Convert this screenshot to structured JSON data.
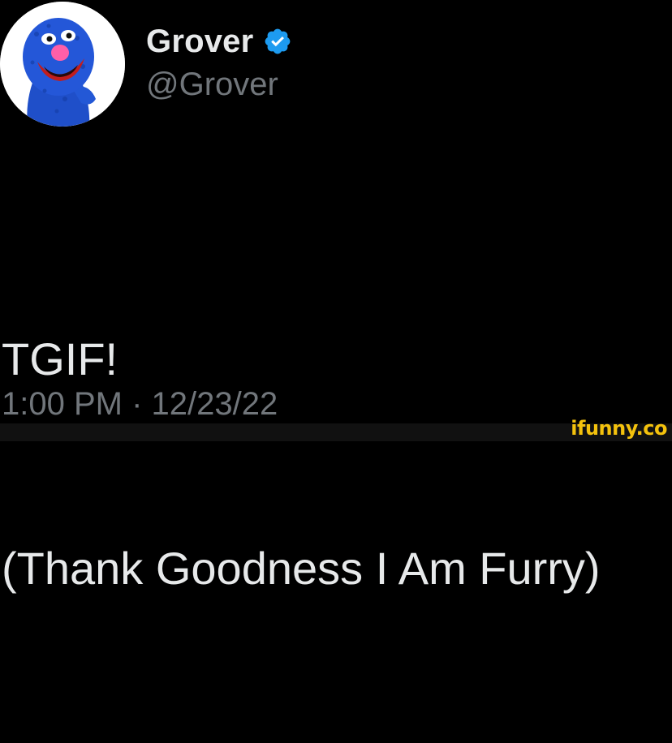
{
  "profile": {
    "display_name": "Grover",
    "handle": "@Grover",
    "verified_icon": "verified-badge-icon",
    "avatar_icon": "grover-avatar",
    "verified_color": "#1d9bf0"
  },
  "tweet": {
    "lines": [
      "TGIF!",
      "(Thank Goodness I Am Furry)"
    ],
    "time": "1:00 PM",
    "separator": "·",
    "date": "12/23/22"
  },
  "watermark": {
    "text": "ifunny.co",
    "color": "#f4c20d"
  },
  "colors": {
    "background": "#000000",
    "primary_text": "#e7e9ea",
    "secondary_text": "#71767b"
  }
}
